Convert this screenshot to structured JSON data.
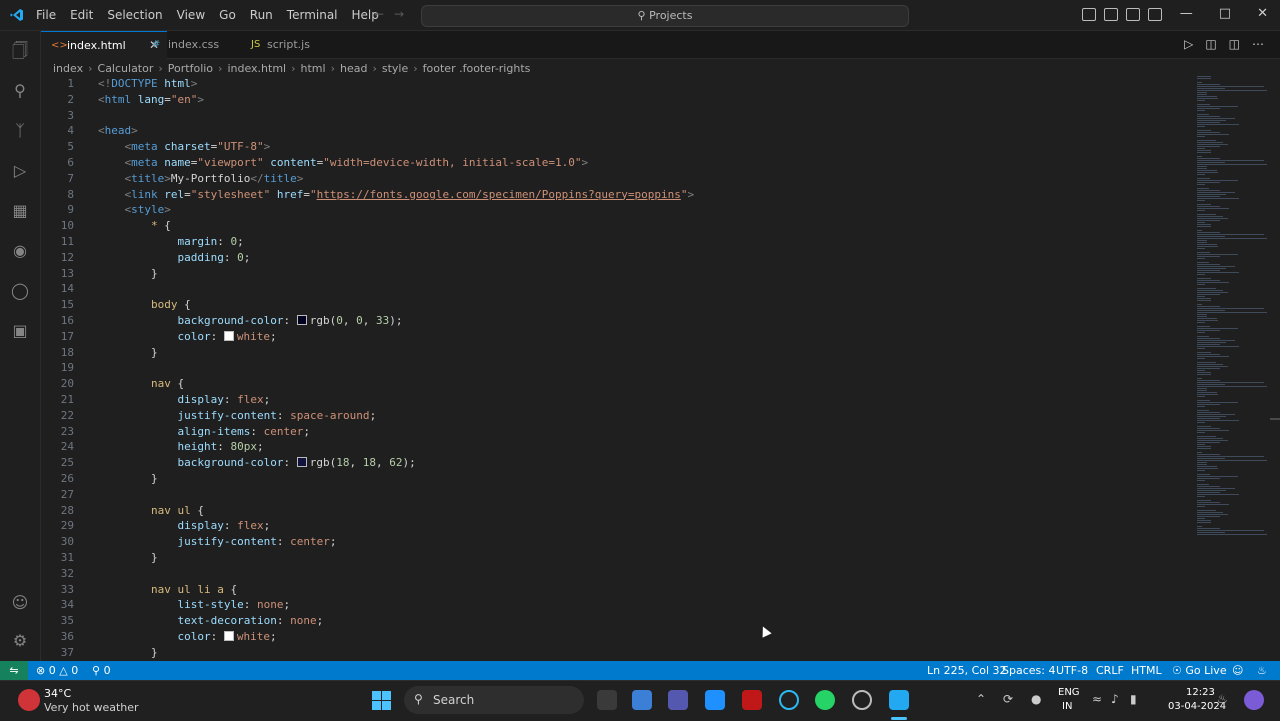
{
  "titlebar": {
    "menu": [
      "File",
      "Edit",
      "Selection",
      "View",
      "Go",
      "Run",
      "Terminal",
      "Help"
    ],
    "command_center": "Projects"
  },
  "tabs": [
    {
      "label": "index.html",
      "active": true,
      "icon": "html-file-icon"
    },
    {
      "label": "index.css",
      "active": false,
      "icon": "css-file-icon"
    },
    {
      "label": "script.js",
      "active": false,
      "icon": "js-file-icon"
    }
  ],
  "breadcrumb": [
    "index",
    "Calculator",
    "Portfolio",
    "index.html",
    "html",
    "head",
    "style",
    "footer .footer-rights"
  ],
  "code": {
    "lines": [
      {
        "n": "1",
        "tokens": [
          [
            "t-punct",
            "<!"
          ],
          [
            "t-tag",
            "DOCTYPE"
          ],
          [
            "t-text",
            " "
          ],
          [
            "t-attr",
            "html"
          ],
          [
            "t-punct",
            ">"
          ]
        ]
      },
      {
        "n": "2",
        "tokens": [
          [
            "t-punct",
            "<"
          ],
          [
            "t-tag",
            "html"
          ],
          [
            "t-text",
            " "
          ],
          [
            "t-attr",
            "lang"
          ],
          [
            "t-text",
            "="
          ],
          [
            "t-str",
            "\"en\""
          ],
          [
            "t-punct",
            ">"
          ]
        ]
      },
      {
        "n": "3",
        "tokens": []
      },
      {
        "n": "4",
        "tokens": [
          [
            "t-punct",
            "<"
          ],
          [
            "t-tag",
            "head"
          ],
          [
            "t-punct",
            ">"
          ]
        ]
      },
      {
        "n": "5",
        "tokens": [
          [
            "t-text",
            "    "
          ],
          [
            "t-punct",
            "<"
          ],
          [
            "t-tag",
            "meta"
          ],
          [
            "t-text",
            " "
          ],
          [
            "t-attr",
            "charset"
          ],
          [
            "t-text",
            "="
          ],
          [
            "t-str",
            "\"UTF-8\""
          ],
          [
            "t-punct",
            ">"
          ]
        ]
      },
      {
        "n": "6",
        "tokens": [
          [
            "t-text",
            "    "
          ],
          [
            "t-punct",
            "<"
          ],
          [
            "t-tag",
            "meta"
          ],
          [
            "t-text",
            " "
          ],
          [
            "t-attr",
            "name"
          ],
          [
            "t-text",
            "="
          ],
          [
            "t-str",
            "\"viewport\""
          ],
          [
            "t-text",
            " "
          ],
          [
            "t-attr",
            "content"
          ],
          [
            "t-text",
            "="
          ],
          [
            "t-str",
            "\"width=device-width, initial-scale=1.0\""
          ],
          [
            "t-punct",
            ">"
          ]
        ]
      },
      {
        "n": "7",
        "tokens": [
          [
            "t-text",
            "    "
          ],
          [
            "t-punct",
            "<"
          ],
          [
            "t-tag",
            "title"
          ],
          [
            "t-punct",
            ">"
          ],
          [
            "t-text",
            "My-Portfolio"
          ],
          [
            "t-punct",
            "</"
          ],
          [
            "t-tag",
            "title"
          ],
          [
            "t-punct",
            ">"
          ]
        ]
      },
      {
        "n": "8",
        "tokens": [
          [
            "t-text",
            "    "
          ],
          [
            "t-punct",
            "<"
          ],
          [
            "t-tag",
            "link"
          ],
          [
            "t-text",
            " "
          ],
          [
            "t-attr",
            "rel"
          ],
          [
            "t-text",
            "="
          ],
          [
            "t-str",
            "\"stylesheet\""
          ],
          [
            "t-text",
            " "
          ],
          [
            "t-attr",
            "href"
          ],
          [
            "t-text",
            "="
          ],
          [
            "t-str",
            "\""
          ],
          [
            "t-link",
            "https://fonts.google.com/specimen/Poppins?query=poppins"
          ],
          [
            "t-str",
            "\""
          ],
          [
            "t-punct",
            ">"
          ]
        ]
      },
      {
        "n": "9",
        "tokens": [
          [
            "t-text",
            "    "
          ],
          [
            "t-punct",
            "<"
          ],
          [
            "t-tag",
            "style"
          ],
          [
            "t-punct",
            ">"
          ]
        ]
      },
      {
        "n": "10",
        "tokens": [
          [
            "t-text",
            "        "
          ],
          [
            "t-sel",
            "*"
          ],
          [
            "t-text",
            " {"
          ]
        ]
      },
      {
        "n": "11",
        "tokens": [
          [
            "t-text",
            "            "
          ],
          [
            "t-prop",
            "margin"
          ],
          [
            "t-text",
            ": "
          ],
          [
            "t-num",
            "0"
          ],
          [
            "t-text",
            ";"
          ]
        ]
      },
      {
        "n": "12",
        "tokens": [
          [
            "t-text",
            "            "
          ],
          [
            "t-prop",
            "padding"
          ],
          [
            "t-text",
            ": "
          ],
          [
            "t-num",
            "0"
          ],
          [
            "t-text",
            ";"
          ]
        ]
      },
      {
        "n": "13",
        "tokens": [
          [
            "t-text",
            "        }"
          ]
        ]
      },
      {
        "n": "14",
        "tokens": []
      },
      {
        "n": "15",
        "tokens": [
          [
            "t-text",
            "        "
          ],
          [
            "t-sel",
            "body"
          ],
          [
            "t-text",
            " {"
          ]
        ]
      },
      {
        "n": "16",
        "tokens": [
          [
            "t-text",
            "            "
          ],
          [
            "t-prop",
            "background-color"
          ],
          [
            "t-text",
            ": "
          ],
          [
            "swatch",
            "#000021"
          ],
          [
            "t-text",
            "rgb("
          ],
          [
            "t-num",
            "0"
          ],
          [
            "t-text",
            ", "
          ],
          [
            "t-num",
            "0"
          ],
          [
            "t-text",
            ", "
          ],
          [
            "t-num",
            "33"
          ],
          [
            "t-text",
            ");"
          ]
        ]
      },
      {
        "n": "17",
        "tokens": [
          [
            "t-text",
            "            "
          ],
          [
            "t-prop",
            "color"
          ],
          [
            "t-text",
            ": "
          ],
          [
            "swatch",
            "#ffffff"
          ],
          [
            "t-val",
            "white"
          ],
          [
            "t-text",
            ";"
          ]
        ]
      },
      {
        "n": "18",
        "tokens": [
          [
            "t-text",
            "        }"
          ]
        ]
      },
      {
        "n": "19",
        "tokens": []
      },
      {
        "n": "20",
        "tokens": [
          [
            "t-text",
            "        "
          ],
          [
            "t-sel",
            "nav"
          ],
          [
            "t-text",
            " {"
          ]
        ]
      },
      {
        "n": "21",
        "tokens": [
          [
            "t-text",
            "            "
          ],
          [
            "t-prop",
            "display"
          ],
          [
            "t-text",
            ": "
          ],
          [
            "t-val",
            "flex"
          ],
          [
            "t-text",
            ";"
          ]
        ]
      },
      {
        "n": "22",
        "tokens": [
          [
            "t-text",
            "            "
          ],
          [
            "t-prop",
            "justify-content"
          ],
          [
            "t-text",
            ": "
          ],
          [
            "t-val",
            "space-around"
          ],
          [
            "t-text",
            ";"
          ]
        ]
      },
      {
        "n": "23",
        "tokens": [
          [
            "t-text",
            "            "
          ],
          [
            "t-prop",
            "align-items"
          ],
          [
            "t-text",
            ": "
          ],
          [
            "t-val",
            "center"
          ],
          [
            "t-text",
            ";"
          ]
        ]
      },
      {
        "n": "24",
        "tokens": [
          [
            "t-text",
            "            "
          ],
          [
            "t-prop",
            "height"
          ],
          [
            "t-text",
            ": "
          ],
          [
            "t-num",
            "80px"
          ],
          [
            "t-text",
            ";"
          ]
        ]
      },
      {
        "n": "25",
        "tokens": [
          [
            "t-text",
            "            "
          ],
          [
            "t-prop",
            "background-color"
          ],
          [
            "t-text",
            ": "
          ],
          [
            "swatch",
            "#12123e"
          ],
          [
            "t-text",
            "rgb("
          ],
          [
            "t-num",
            "18"
          ],
          [
            "t-text",
            ", "
          ],
          [
            "t-num",
            "18"
          ],
          [
            "t-text",
            ", "
          ],
          [
            "t-num",
            "62"
          ],
          [
            "t-text",
            ");"
          ]
        ]
      },
      {
        "n": "26",
        "tokens": [
          [
            "t-text",
            "        }"
          ]
        ]
      },
      {
        "n": "27",
        "tokens": []
      },
      {
        "n": "28",
        "tokens": [
          [
            "t-text",
            "        "
          ],
          [
            "t-sel",
            "nav ul"
          ],
          [
            "t-text",
            " {"
          ]
        ]
      },
      {
        "n": "29",
        "tokens": [
          [
            "t-text",
            "            "
          ],
          [
            "t-prop",
            "display"
          ],
          [
            "t-text",
            ": "
          ],
          [
            "t-val",
            "flex"
          ],
          [
            "t-text",
            ";"
          ]
        ]
      },
      {
        "n": "30",
        "tokens": [
          [
            "t-text",
            "            "
          ],
          [
            "t-prop",
            "justify-content"
          ],
          [
            "t-text",
            ": "
          ],
          [
            "t-val",
            "center"
          ],
          [
            "t-text",
            ";"
          ]
        ]
      },
      {
        "n": "31",
        "tokens": [
          [
            "t-text",
            "        }"
          ]
        ]
      },
      {
        "n": "32",
        "tokens": []
      },
      {
        "n": "33",
        "tokens": [
          [
            "t-text",
            "        "
          ],
          [
            "t-sel",
            "nav ul li a"
          ],
          [
            "t-text",
            " {"
          ]
        ]
      },
      {
        "n": "34",
        "tokens": [
          [
            "t-text",
            "            "
          ],
          [
            "t-prop",
            "list-style"
          ],
          [
            "t-text",
            ": "
          ],
          [
            "t-val",
            "none"
          ],
          [
            "t-text",
            ";"
          ]
        ]
      },
      {
        "n": "35",
        "tokens": [
          [
            "t-text",
            "            "
          ],
          [
            "t-prop",
            "text-decoration"
          ],
          [
            "t-text",
            ": "
          ],
          [
            "t-val",
            "none"
          ],
          [
            "t-text",
            ";"
          ]
        ]
      },
      {
        "n": "36",
        "tokens": [
          [
            "t-text",
            "            "
          ],
          [
            "t-prop",
            "color"
          ],
          [
            "t-text",
            ": "
          ],
          [
            "swatch",
            "#ffffff"
          ],
          [
            "t-val",
            "white"
          ],
          [
            "t-text",
            ";"
          ]
        ]
      },
      {
        "n": "37",
        "tokens": [
          [
            "t-text",
            "        }"
          ]
        ]
      }
    ]
  },
  "statusbar": {
    "errors": "0",
    "warnings": "0",
    "ports": "0",
    "position": "Ln 225, Col 32",
    "spaces": "Spaces: 4",
    "encoding": "UTF-8",
    "eol": "CRLF",
    "language": "HTML",
    "golive": "Go Live"
  },
  "taskbar": {
    "weather_temp": "34°C",
    "weather_text": "Very hot weather",
    "search": "Search",
    "lang": "ENG",
    "region": "IN",
    "time": "12:23",
    "date": "03-04-2024"
  },
  "colors": {
    "accent": "#007acc",
    "remote": "#16825d"
  }
}
